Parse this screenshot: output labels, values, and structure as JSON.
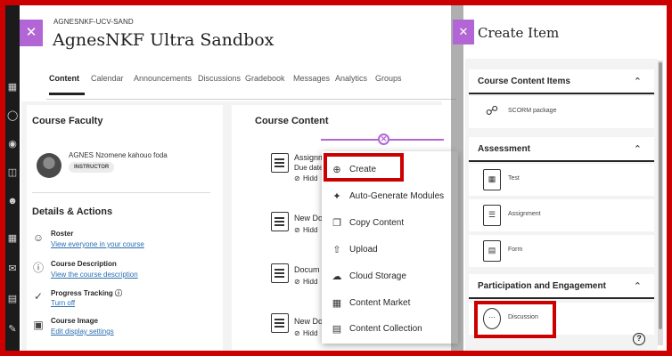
{
  "colors": {
    "frame_border": "#cc0000",
    "accent": "#b266d5",
    "link": "#2a6fb0",
    "nav_bg": "#1b1b1b"
  },
  "course": {
    "close_icon": "close-icon",
    "breadcrumb": "AGNESNKF-UCV-SAND",
    "title": "AgnesNKF Ultra Sandbox",
    "tabs": [
      "Content",
      "Calendar",
      "Announcements",
      "Discussions",
      "Gradebook",
      "Messages",
      "Analytics",
      "Groups"
    ],
    "active_tab": "Content"
  },
  "faculty": {
    "heading": "Course Faculty",
    "name": "AGNES Nzomene kahouo foda",
    "role": "INSTRUCTOR"
  },
  "details": {
    "heading": "Details & Actions",
    "items": [
      {
        "icon": "roster-icon",
        "title": "Roster",
        "link": "View everyone in your course"
      },
      {
        "icon": "info-icon",
        "title": "Course Description",
        "link": "View the course description"
      },
      {
        "icon": "check-circle-icon",
        "title": "Progress Tracking",
        "link": "Turn off"
      },
      {
        "icon": "image-icon",
        "title": "Course Image",
        "link": "Edit display settings"
      }
    ]
  },
  "content": {
    "heading": "Course Content",
    "items": [
      {
        "title": "Assignm",
        "meta1": "Due date",
        "meta2": "Hidd"
      },
      {
        "title": "New Do",
        "meta2": "Hidd"
      },
      {
        "title": "Docum",
        "meta2": "Hidd"
      },
      {
        "title": "New Do",
        "meta2": "Hidd"
      }
    ]
  },
  "create_menu": {
    "items": [
      {
        "icon": "plus-circle-icon",
        "label": "Create"
      },
      {
        "icon": "sparkle-icon",
        "label": "Auto-Generate Modules"
      },
      {
        "icon": "copy-icon",
        "label": "Copy Content"
      },
      {
        "icon": "upload-icon",
        "label": "Upload"
      },
      {
        "icon": "cloud-icon",
        "label": "Cloud Storage"
      },
      {
        "icon": "store-icon",
        "label": "Content Market"
      },
      {
        "icon": "collection-icon",
        "label": "Content Collection"
      }
    ]
  },
  "panel": {
    "title": "Create Item",
    "sections": [
      {
        "label": "Course Content Items",
        "items": [
          "SCORM package"
        ]
      },
      {
        "label": "Assessment",
        "items": [
          "Test",
          "Assignment",
          "Form"
        ]
      },
      {
        "label": "Participation and Engagement",
        "items": [
          "Discussion"
        ]
      }
    ],
    "help_icon": "help-icon"
  }
}
